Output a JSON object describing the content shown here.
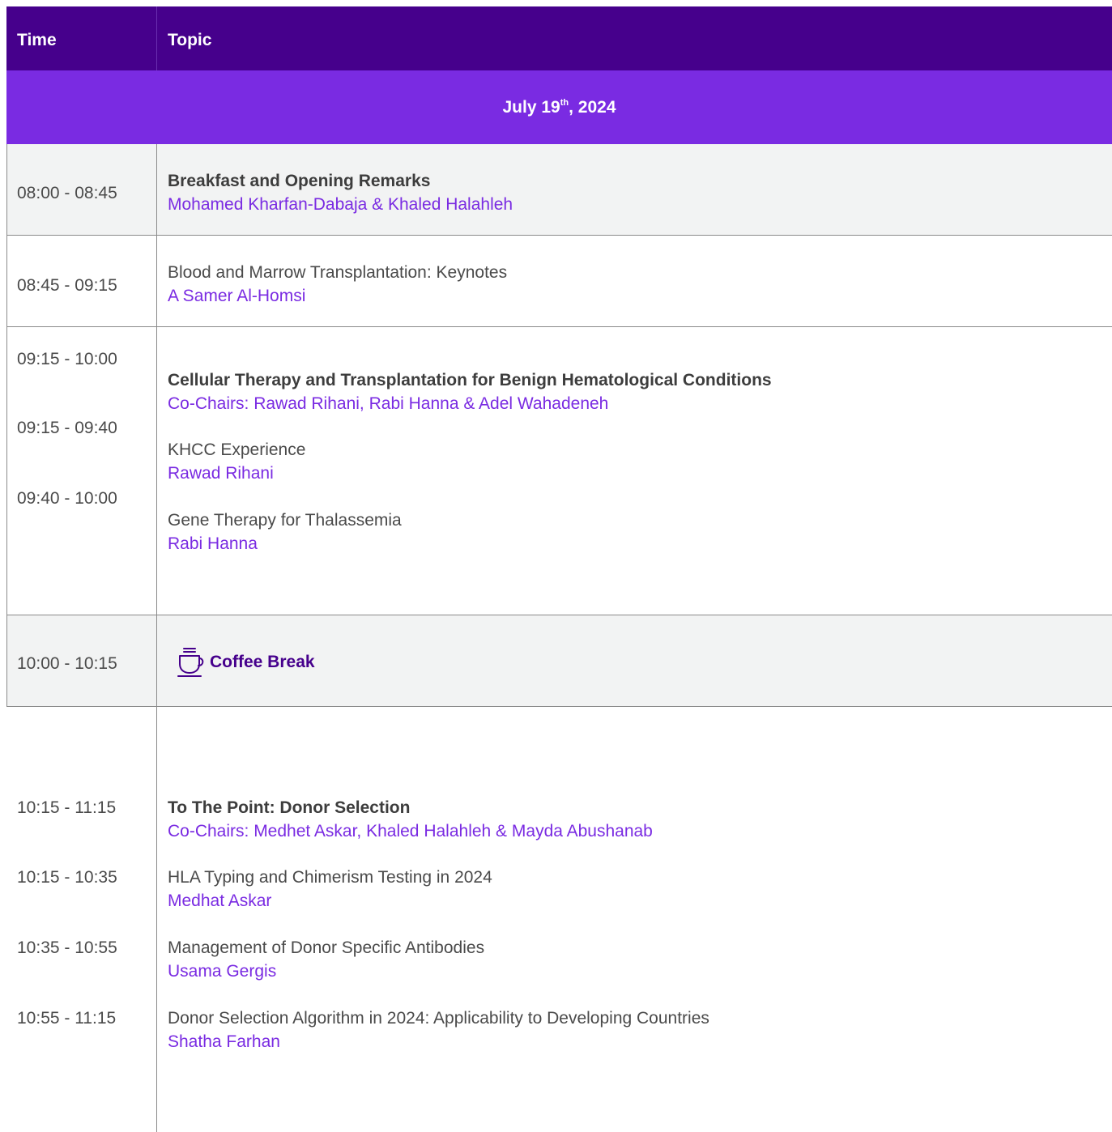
{
  "header": {
    "time_label": "Time",
    "topic_label": "Topic"
  },
  "date": {
    "day": "July 19",
    "suffix": "th",
    "year": ", 2024"
  },
  "colors": {
    "header": "#46008c",
    "date_band": "#7a2be2",
    "speaker": "#7a2be2",
    "row_shade": "#f2f3f3"
  },
  "sessions": [
    {
      "time": "08:00 - 08:45",
      "title": "Breakfast and Opening Remarks",
      "speaker": "Mohamed Kharfan-Dabaja & Khaled Halahleh"
    },
    {
      "time": "08:45 - 09:15",
      "title": "Blood and Marrow Transplantation: Keynotes",
      "speaker": "A Samer Al-Homsi"
    },
    {
      "times": [
        "09:15 - 10:00",
        "09:15 - 09:40",
        "09:40 - 10:00"
      ],
      "title": "Cellular Therapy and Transplantation for Benign Hematological Conditions",
      "chairs": "Co-Chairs: Rawad Rihani, Rabi Hanna & Adel Wahadeneh",
      "talks": [
        {
          "title": "KHCC Experience",
          "speaker": "Rawad Rihani"
        },
        {
          "title": "Gene Therapy for Thalassemia",
          "speaker": "Rabi Hanna"
        }
      ]
    },
    {
      "time": "10:00 - 10:15",
      "icon": "coffee-cup-icon",
      "title": "Coffee Break"
    },
    {
      "times": [
        "10:15 - 11:15",
        "10:15 - 10:35",
        "10:35 - 10:55",
        "10:55 - 11:15"
      ],
      "title": "To The Point: Donor Selection",
      "chairs": "Co-Chairs: Medhet Askar, Khaled Halahleh & Mayda Abushanab",
      "talks": [
        {
          "title": "HLA Typing and Chimerism Testing in 2024",
          "speaker": "Medhat Askar"
        },
        {
          "title": "Management of Donor Specific Antibodies",
          "speaker": "Usama Gergis"
        },
        {
          "title": "Donor Selection Algorithm in 2024: Applicability to Developing Countries",
          "speaker": "Shatha Farhan"
        }
      ]
    }
  ]
}
